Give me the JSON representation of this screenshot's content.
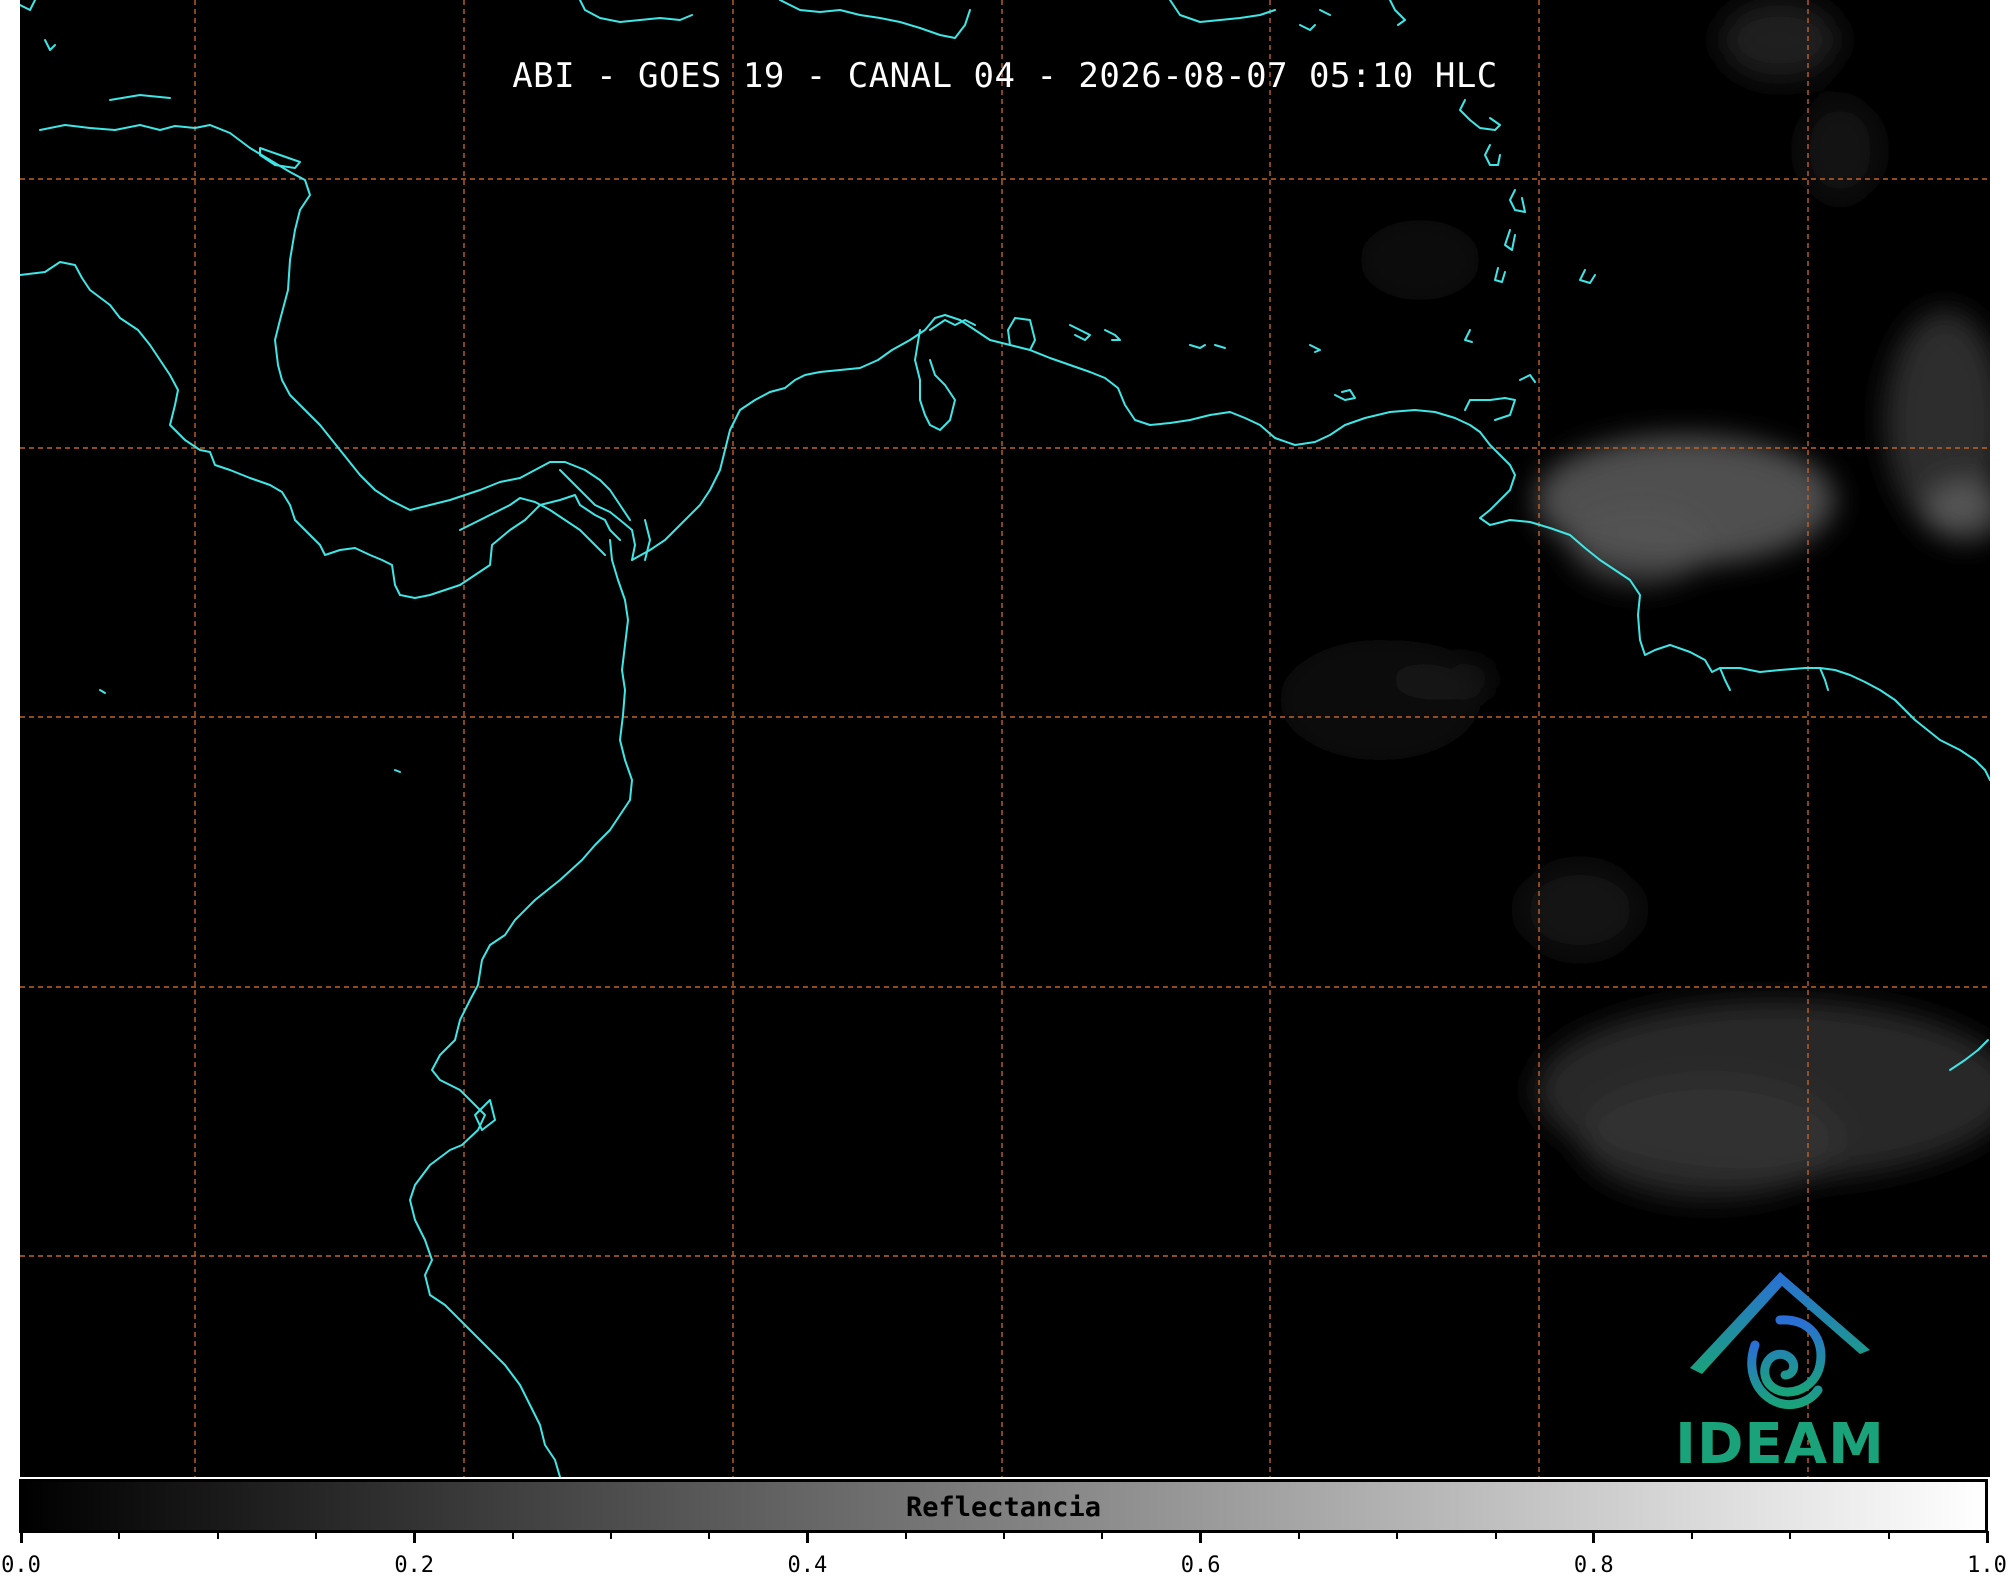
{
  "title": "ABI - GOES 19 - CANAL 04 - 2026-08-07 05:10 HLC",
  "logo": {
    "icon": "ideam-logo-icon",
    "text": "IDEAM"
  },
  "colorbar": {
    "label": "Reflectancia",
    "range": [
      0.0,
      1.0
    ],
    "ticks": [
      "0.0",
      "0.2",
      "0.4",
      "0.6",
      "0.8",
      "1.0"
    ],
    "colors": {
      "start": "#000000",
      "end": "#ffffff"
    }
  },
  "map_style": {
    "background": "#000000",
    "coastline_color": "#3fe6e6",
    "gridline_color": "#c0622a",
    "gridline_style": "dashed"
  }
}
